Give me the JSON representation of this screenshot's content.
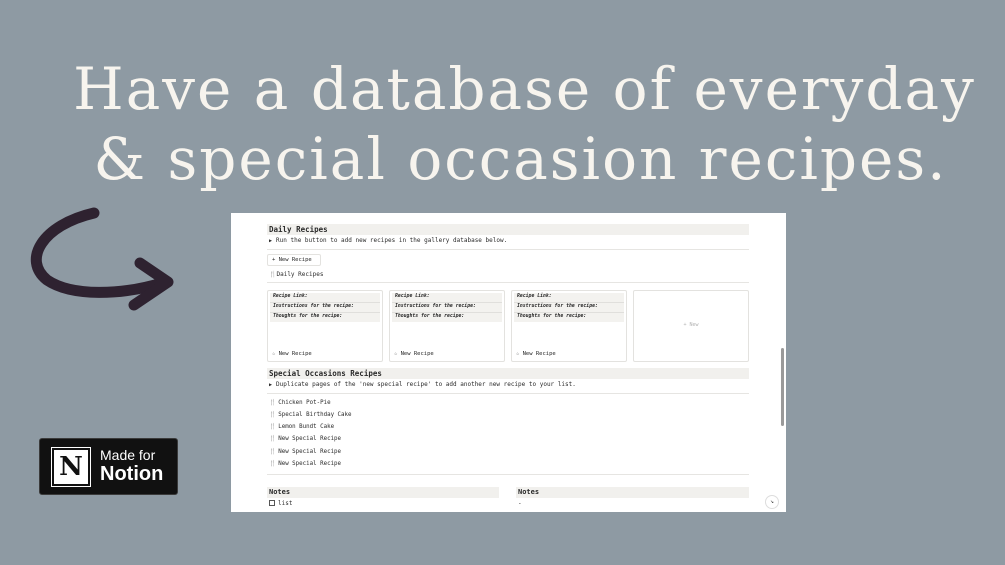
{
  "headline": {
    "line1": "Have a database of everyday",
    "line2": "& special occasion recipes."
  },
  "badge": {
    "line1": "Made for",
    "line2": "Notion",
    "logo_letter": "N"
  },
  "daily": {
    "title": "Daily Recipes",
    "toggle_text": "Run the button to add new recipes in the gallery database below.",
    "button_label": "New Recipe",
    "database_title": "Daily Recipes",
    "cards": [
      {
        "lines": [
          "Recipe Link:",
          "Instructions for the recipe:",
          "Thoughts for the recipe:"
        ],
        "name": "New Recipe"
      },
      {
        "lines": [
          "Recipe Link:",
          "Instructions for the recipe:",
          "Thoughts for the recipe:"
        ],
        "name": "New Recipe"
      },
      {
        "lines": [
          "Recipe Link:",
          "Instructions for the recipe:",
          "Thoughts for the recipe:"
        ],
        "name": "New Recipe"
      }
    ],
    "new_card_label": "+ New"
  },
  "special": {
    "title": "Special Occasions Recipes",
    "toggle_text": "Duplicate pages of the 'new special recipe' to add another new recipe to your list.",
    "items": [
      "Chicken Pot-Pie",
      "Special Birthday Cake",
      "Lemon Bundt Cake",
      "New Special Recipe",
      "New Special Recipe",
      "New Special Recipe"
    ]
  },
  "notes": {
    "left_title": "Notes",
    "right_title": "Notes",
    "check_item": "list",
    "right_text": "-"
  },
  "colors": {
    "background": "#8e9aa3",
    "headline": "#f7f4ee",
    "arrow": "#2e2230"
  }
}
